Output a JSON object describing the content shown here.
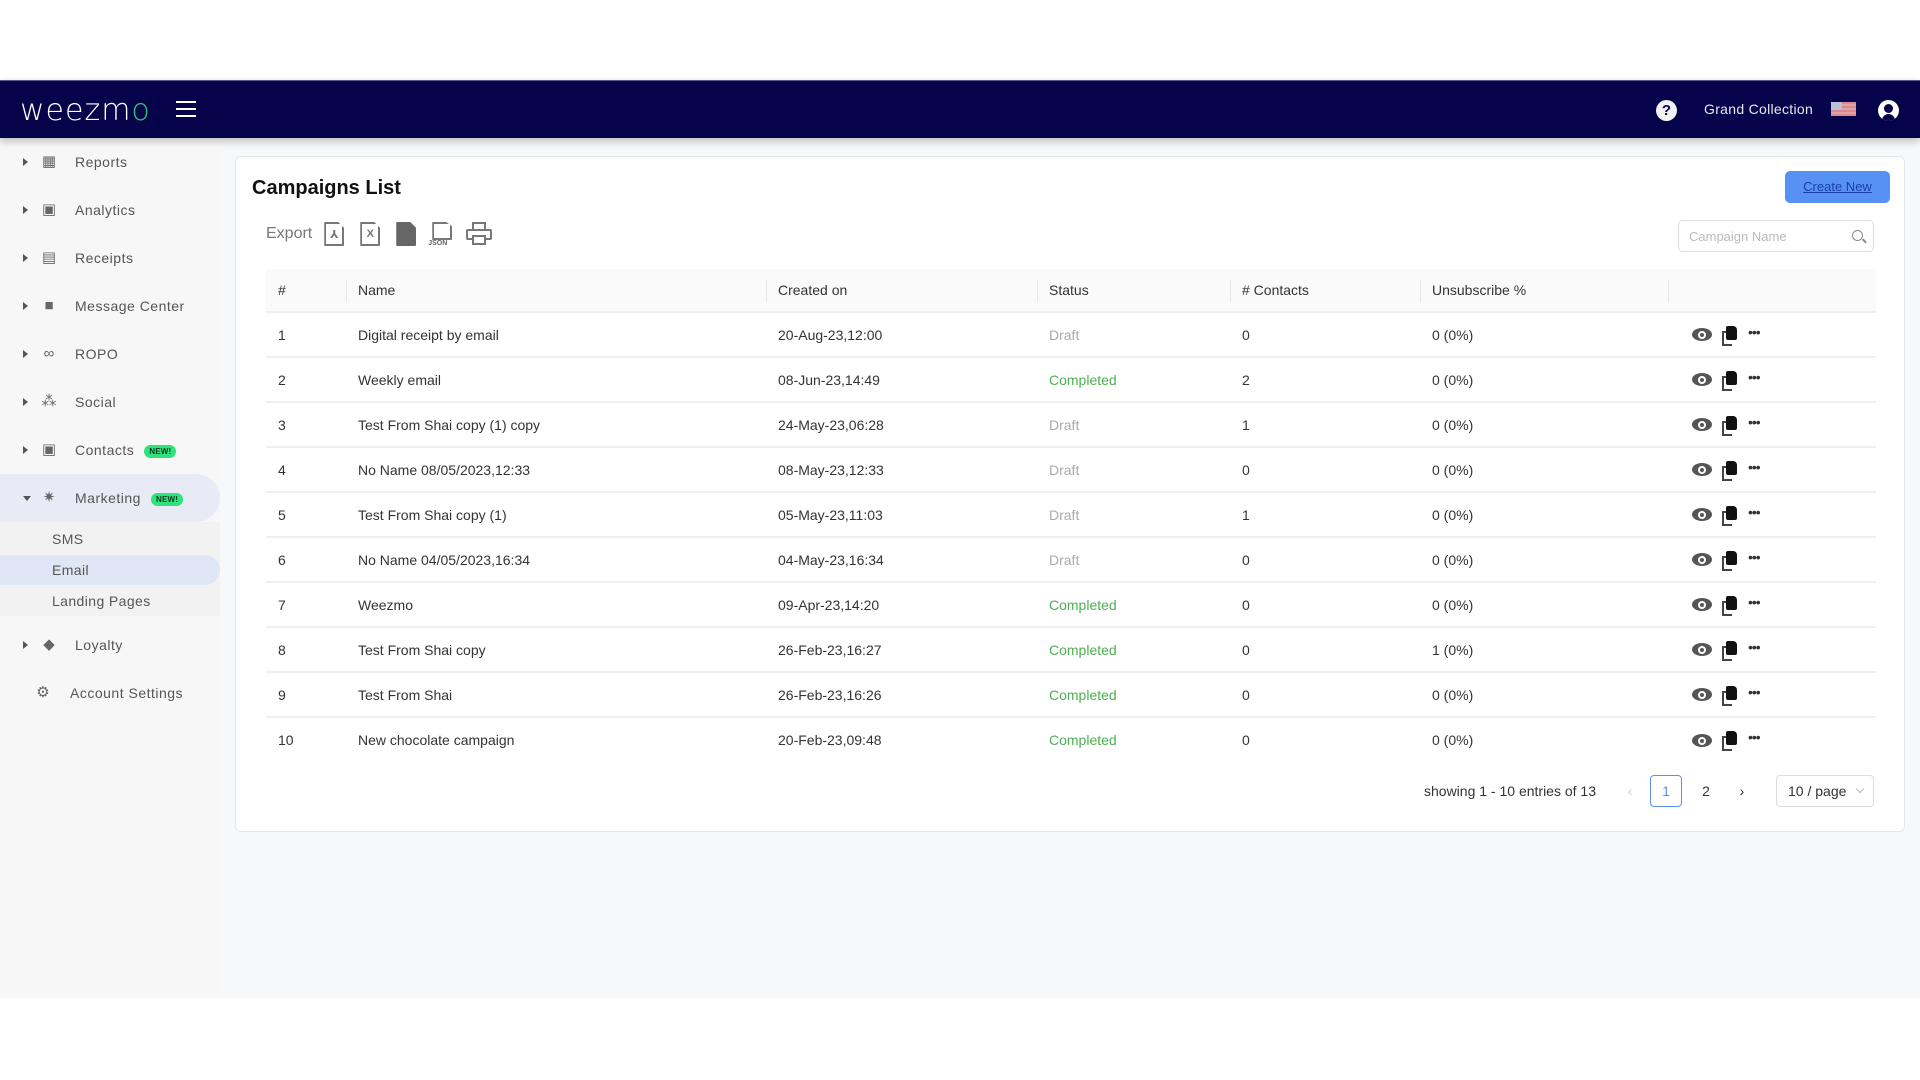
{
  "header": {
    "logo": "weezm",
    "logo_accent": "o",
    "account_name": "Grand Collection",
    "help_label": "?"
  },
  "sidebar": {
    "items": [
      {
        "label": "Reports",
        "icon": "dashboard-icon"
      },
      {
        "label": "Analytics",
        "icon": "analytics-icon"
      },
      {
        "label": "Receipts",
        "icon": "receipt-icon"
      },
      {
        "label": "Message Center",
        "icon": "message-icon"
      },
      {
        "label": "ROPO",
        "icon": "infinity-icon"
      },
      {
        "label": "Social",
        "icon": "people-icon"
      },
      {
        "label": "Contacts",
        "icon": "contacts-icon",
        "badge": "NEW!"
      },
      {
        "label": "Marketing",
        "icon": "party-popper-icon",
        "badge": "NEW!",
        "expanded": true
      },
      {
        "label": "Loyalty",
        "icon": "tag-icon"
      },
      {
        "label": "Account Settings",
        "icon": "gear-icon"
      }
    ],
    "marketing_sub": [
      {
        "label": "SMS"
      },
      {
        "label": "Email",
        "active": true
      },
      {
        "label": "Landing Pages"
      }
    ]
  },
  "main": {
    "title": "Campaigns List",
    "create_label": "Create New",
    "export_label": "Export",
    "export_json_label": "JSON",
    "search_placeholder": "Campaign Name",
    "columns": [
      "#",
      "Name",
      "Created on",
      "Status",
      "# Contacts",
      "Unsubscribe %",
      ""
    ],
    "rows": [
      {
        "n": "1",
        "name": "Digital receipt by email",
        "created": "20-Aug-23,12:00",
        "status": "Draft",
        "contacts": "0",
        "unsub": "0 (0%)"
      },
      {
        "n": "2",
        "name": "Weekly email",
        "created": "08-Jun-23,14:49",
        "status": "Completed",
        "contacts": "2",
        "unsub": "0 (0%)"
      },
      {
        "n": "3",
        "name": "Test From Shai copy (1) copy",
        "created": "24-May-23,06:28",
        "status": "Draft",
        "contacts": "1",
        "unsub": "0 (0%)"
      },
      {
        "n": "4",
        "name": "No Name 08/05/2023,12:33",
        "created": "08-May-23,12:33",
        "status": "Draft",
        "contacts": "0",
        "unsub": "0 (0%)"
      },
      {
        "n": "5",
        "name": "Test From Shai copy (1)",
        "created": "05-May-23,11:03",
        "status": "Draft",
        "contacts": "1",
        "unsub": "0 (0%)"
      },
      {
        "n": "6",
        "name": "No Name 04/05/2023,16:34",
        "created": "04-May-23,16:34",
        "status": "Draft",
        "contacts": "0",
        "unsub": "0 (0%)"
      },
      {
        "n": "7",
        "name": "Weezmo",
        "created": "09-Apr-23,14:20",
        "status": "Completed",
        "contacts": "0",
        "unsub": "0 (0%)"
      },
      {
        "n": "8",
        "name": "Test From Shai copy",
        "created": "26-Feb-23,16:27",
        "status": "Completed",
        "contacts": "0",
        "unsub": "1 (0%)"
      },
      {
        "n": "9",
        "name": "Test From Shai",
        "created": "26-Feb-23,16:26",
        "status": "Completed",
        "contacts": "0",
        "unsub": "0 (0%)"
      },
      {
        "n": "10",
        "name": "New chocolate campaign",
        "created": "20-Feb-23,09:48",
        "status": "Completed",
        "contacts": "0",
        "unsub": "0 (0%)"
      }
    ],
    "pagination": {
      "info": "showing 1 - 10 entries of 13",
      "pages": [
        "1",
        "2"
      ],
      "current": "1",
      "per_page": "10 / page"
    }
  },
  "colors": {
    "header_bg": "#05034a",
    "accent": "#5891f4",
    "completed": "#4caf50",
    "draft": "#aaaaaa",
    "badge_new": "#2ee27c"
  }
}
